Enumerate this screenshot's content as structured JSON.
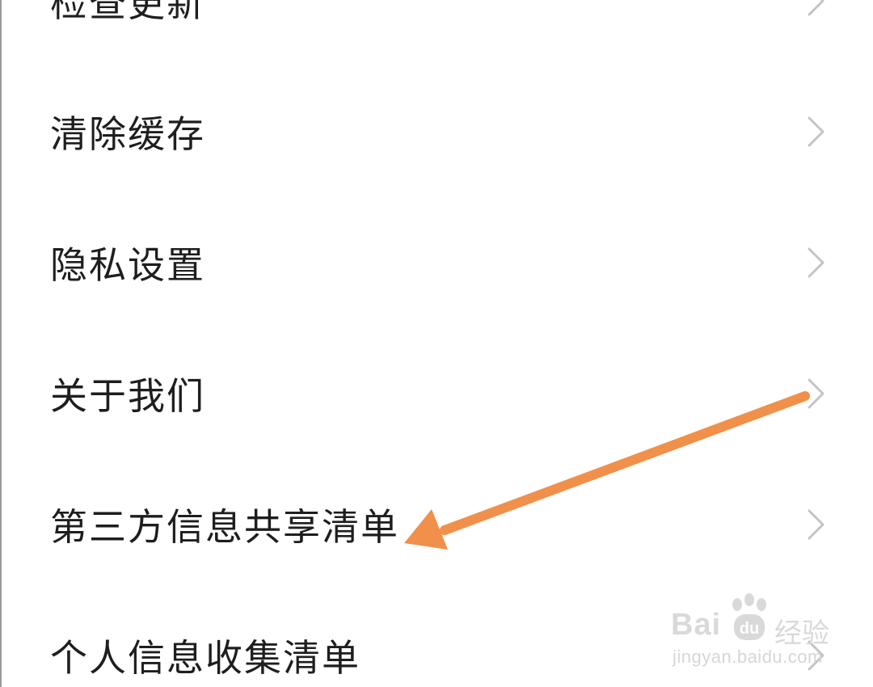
{
  "settings_menu": {
    "items": [
      {
        "label": "检查更新"
      },
      {
        "label": "清除缓存"
      },
      {
        "label": "隐私设置"
      },
      {
        "label": "关于我们"
      },
      {
        "label": "第三方信息共享清单"
      },
      {
        "label": "个人信息收集清单"
      }
    ],
    "chevron_icon": "chevron-right-icon"
  },
  "annotation": {
    "icon": "arrow-annotation-icon",
    "color": "#F0904A"
  },
  "watermark": {
    "brand": "Bai",
    "suffix": "经验",
    "url": "jingyan.baidu.com"
  },
  "colors": {
    "text": "#1E1E1E",
    "chevron": "#C4C4C4",
    "background": "#FFFFFF"
  }
}
